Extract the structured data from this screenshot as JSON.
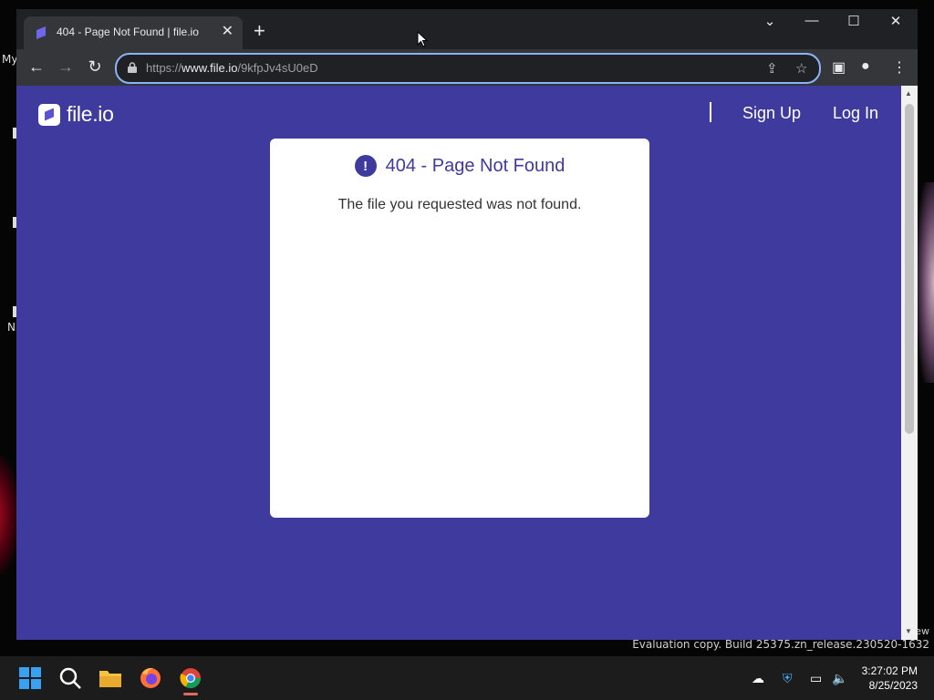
{
  "desktop": {
    "label_top": "My",
    "label_mid": "N",
    "watermark": "Evaluation copy. Build 25375.zn_release.230520-1632",
    "side_fragment": "ew"
  },
  "browser": {
    "tab": {
      "title": "404 - Page Not Found | file.io",
      "close": "✕"
    },
    "new_tab": "+",
    "window_controls": {
      "dropdown": "⌄",
      "minimize": "—",
      "maximize": "☐",
      "close": "✕"
    },
    "nav": {
      "back": "←",
      "forward": "→",
      "reload": "↻"
    },
    "address": {
      "scheme": "https://",
      "host": "www.file.io",
      "path": "/9kfpJv4sU0eD"
    },
    "toolbar_icons": {
      "share": "⇪",
      "bookmark": "☆",
      "side_panel": "▣",
      "profile": "●",
      "menu": "⋮"
    }
  },
  "site": {
    "logo_text": "file.io",
    "nav": {
      "signup": "Sign Up",
      "login": "Log In"
    },
    "card": {
      "icon": "!",
      "title": "404 - Page Not Found",
      "message": "The file you requested was not found."
    }
  },
  "taskbar": {
    "time": "3:27:02 PM",
    "date": "8/25/2023"
  },
  "colors": {
    "page_bg": "#3f3a9d",
    "accent": "#8ab4f8",
    "browser_chrome": "#35363a"
  }
}
